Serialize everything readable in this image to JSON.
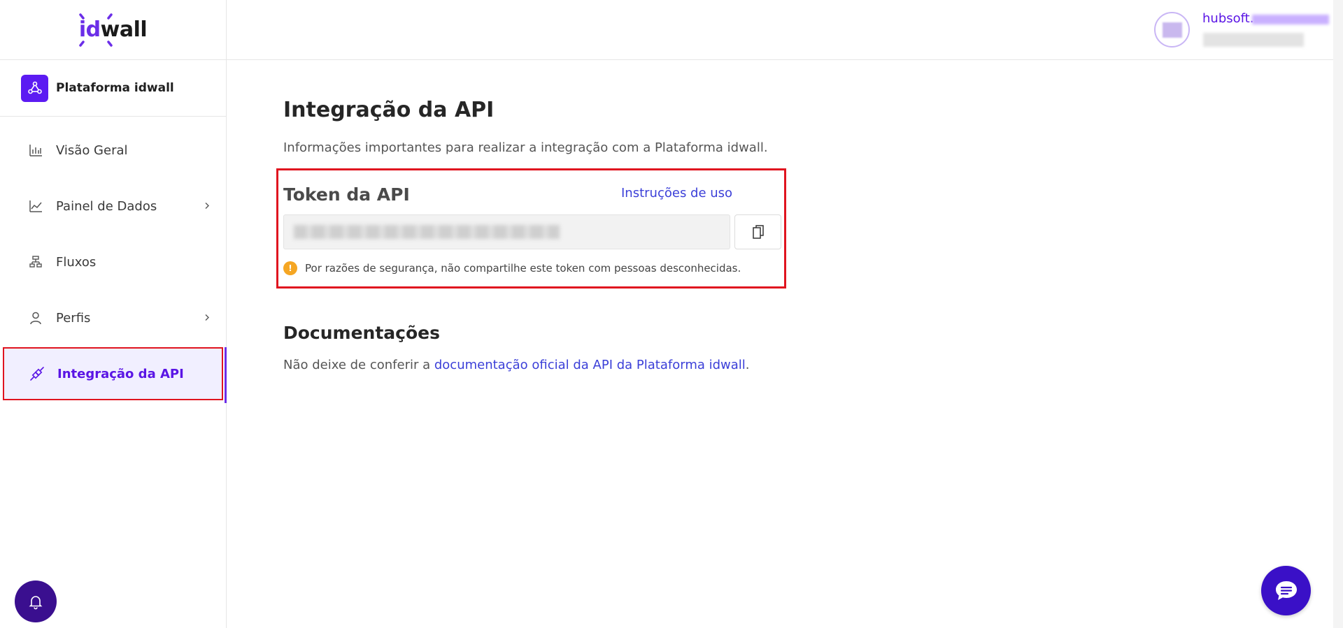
{
  "brand": {
    "logo_id": "id",
    "logo_wall": "wall",
    "platform_name": "Plataforma idwall",
    "accent_color": "#6b2ee8"
  },
  "sidebar": {
    "items": [
      {
        "label": "Visão Geral",
        "icon": "bar-chart-icon",
        "has_chevron": false
      },
      {
        "label": "Painel de Dados",
        "icon": "line-chart-icon",
        "has_chevron": true
      },
      {
        "label": "Fluxos",
        "icon": "flow-icon",
        "has_chevron": false
      },
      {
        "label": "Perfis",
        "icon": "user-icon",
        "has_chevron": true
      },
      {
        "label": "Integração da API",
        "icon": "plug-icon",
        "has_chevron": false,
        "active": true
      }
    ],
    "chevron": ">"
  },
  "header": {
    "user_name": "hubsoft."
  },
  "main": {
    "title": "Integração da API",
    "description": "Informações importantes para realizar a integração com a Plataforma idwall.",
    "token": {
      "title": "Token da API",
      "instructions_link": "Instruções de uso",
      "warning_icon": "!",
      "warning": "Por razões de segurança, não compartilhe este token com pessoas desconhecidas."
    },
    "docs": {
      "title": "Documentações",
      "text_before": "Não deixe de conferir a ",
      "link": "documentação oficial da API da Plataforma idwall",
      "text_after": "."
    }
  }
}
